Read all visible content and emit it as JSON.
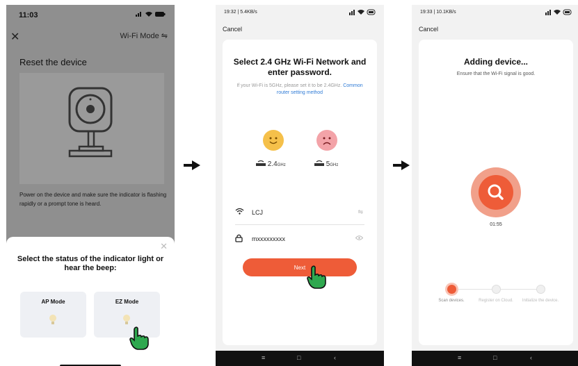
{
  "screen1": {
    "time": "11:03",
    "close_glyph": "✕",
    "wifi_mode": "Wi-Fi Mode ⇋",
    "title": "Reset the device",
    "description": "Power on the device and make sure the indicator is flashing rapidly or a prompt tone is heard.",
    "sheet_close_glyph": "✕",
    "sheet_prompt": "Select the status of the indicator light or hear the beep:",
    "modes": [
      {
        "label": "AP Mode"
      },
      {
        "label": "EZ Mode"
      }
    ]
  },
  "screen2": {
    "status": "19:32 | 5.4KB/s",
    "cancel": "Cancel",
    "heading": "Select 2.4 GHz Wi-Fi Network and enter password.",
    "hint": "If your Wi-Fi is 5GHz, please set it to be 2.4GHz.",
    "hint_link": "Common router setting method",
    "band_24": "2.4",
    "band_24_unit": "GHz",
    "band_5": "5",
    "band_5_unit": "GHz",
    "ssid": "LCJ",
    "password": "mxxxxxxxxx",
    "next_label": "Next"
  },
  "screen3": {
    "status": "19:33 | 10.1KB/s",
    "cancel": "Cancel",
    "heading": "Adding device...",
    "subheading": "Ensure that the Wi-Fi signal is good.",
    "timer": "01:55",
    "steps": [
      {
        "label": "Scan devices."
      },
      {
        "label": "Register on Cloud."
      },
      {
        "label": "Initialize the device."
      }
    ]
  },
  "nav": {
    "menu": "≡",
    "home": "□",
    "back": "‹"
  },
  "colors": {
    "accent": "#ee5c38",
    "link": "#2f7bd6",
    "happy": "#f5c04a",
    "sad": "#f3a3a8"
  },
  "icons": [
    "wifi-icon",
    "lock-icon",
    "search-icon",
    "pointing-hand-icon",
    "arrow-right-icon",
    "eye-icon"
  ]
}
